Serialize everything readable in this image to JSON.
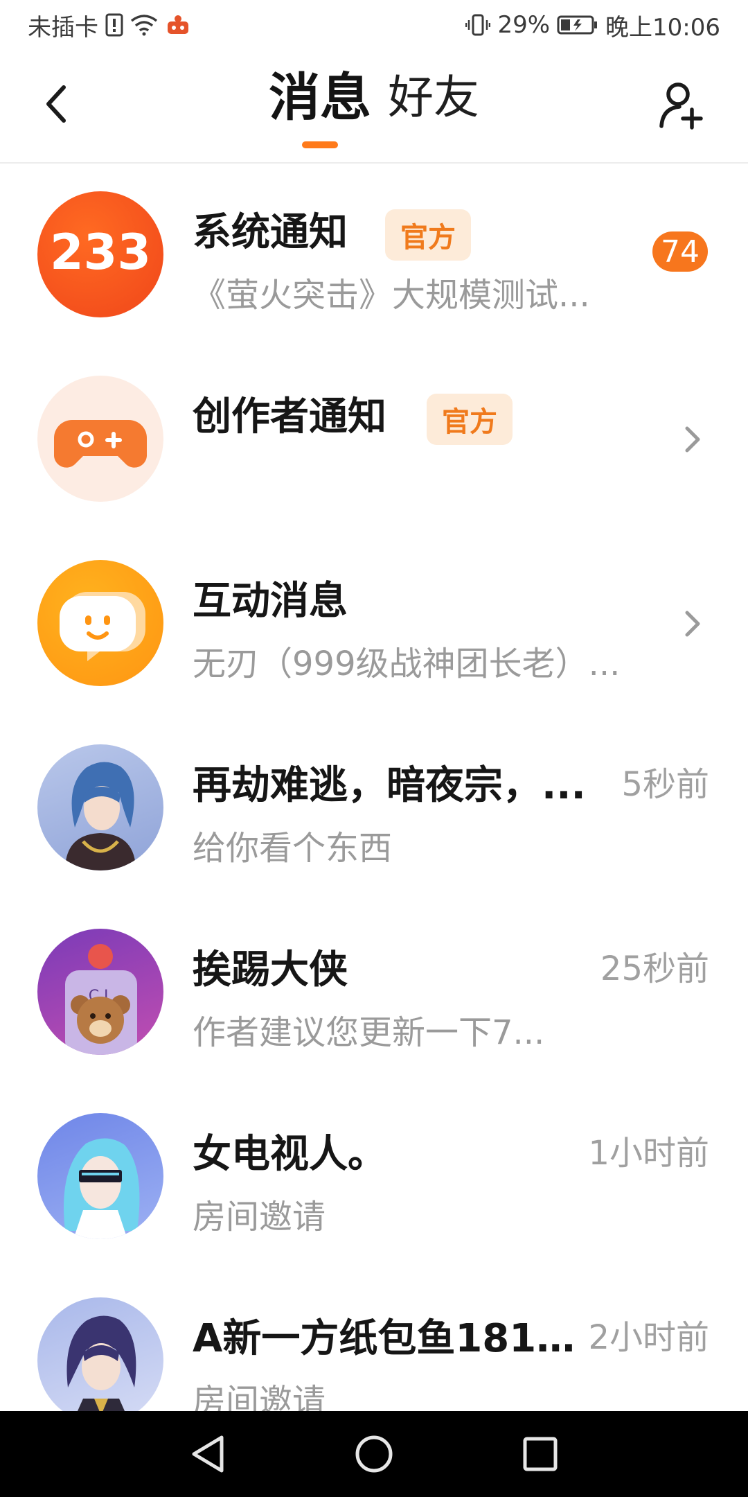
{
  "status_bar": {
    "carrier": "未插卡",
    "battery": "29%",
    "time": "晚上10:06"
  },
  "header": {
    "tabs": [
      {
        "label": "消息",
        "active": true
      },
      {
        "label": "好友",
        "active": false
      }
    ],
    "accent": "#ff7a1a"
  },
  "messages": [
    {
      "title": "系统通知",
      "badge": "官方",
      "subtitle": "《萤火突击》大规模测试...",
      "count": "74",
      "avatar": "233-logo",
      "avatar_text": "233"
    },
    {
      "title": "创作者通知",
      "badge": "官方",
      "subtitle": "",
      "avatar": "gamepad-icon"
    },
    {
      "title": "互动消息",
      "subtitle": "无刃（999级战神团长老）...",
      "avatar": "chat-bubble-icon"
    },
    {
      "title": "再劫难逃，暗夜宗，...",
      "subtitle": "给你看个东西",
      "time": "5秒前",
      "avatar": "anime-avatar"
    },
    {
      "title": "挨踢大侠",
      "subtitle": "作者建议您更新一下7...",
      "time": "25秒前",
      "avatar": "anime-avatar"
    },
    {
      "title": "女电视人。",
      "subtitle": "房间邀请",
      "time": "1小时前",
      "avatar": "anime-avatar"
    },
    {
      "title": "A新一方纸包鱼181...",
      "subtitle": "房间邀请",
      "time": "2小时前",
      "avatar": "anime-avatar"
    }
  ]
}
